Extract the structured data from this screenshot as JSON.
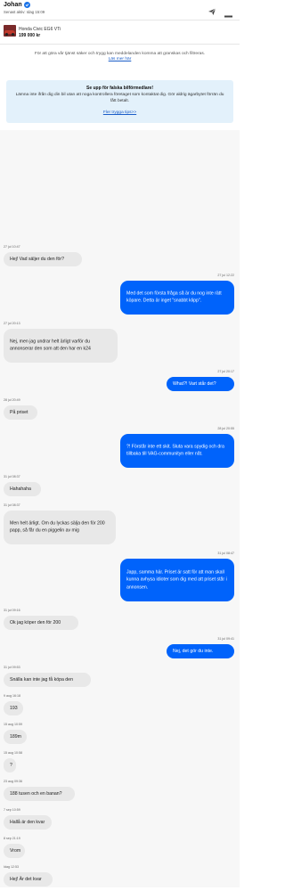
{
  "header": {
    "name": "Johan",
    "last_seen": "Senast aktiv: Idag 15:09"
  },
  "listing": {
    "title": "Honda Civic EG6 VTi",
    "price": "199 000 kr"
  },
  "notice": {
    "text": "För att göra vår tjänst säker och trygg kan meddelanden komma att granskas och filtreras.",
    "link": "Läs mer här"
  },
  "warning": {
    "title": "Se upp för falska bilförmedlare!",
    "text": "Lämna inte ifrån dig din bil utan att noga kontrollera företaget som kontaktat dig. Gör aldrig ägarbytet förrän du fått betalt.",
    "link": "Fler trygga tips>>"
  },
  "messages": [
    {
      "dir": "in",
      "time": "27 jul 10:47",
      "text": "Hej! Vad säljer du den för?"
    },
    {
      "dir": "out",
      "time": "27 jul 12:22",
      "text": "Med det som första fråga så är du nog inte rätt köpare. Detta är inget \"snabbt klipp\"."
    },
    {
      "dir": "in",
      "time": "27 jul 20:13",
      "text": "Nej, men jag undrar helt ärligt varför du annonserar den som att den har en k24"
    },
    {
      "dir": "out",
      "time": "27 jul 20:17",
      "text": "What?! Vart står det?"
    },
    {
      "dir": "in",
      "time": "28 jul 20:49",
      "text": "På priset"
    },
    {
      "dir": "out",
      "time": "28 jul 20:55",
      "text": "?! Förstår inte ett skit. Sluta vara spydig och dra tillbaka till VAG-communityn eller nåt."
    },
    {
      "dir": "in",
      "time": "31 jul 08:37",
      "text": "Hahahaha"
    },
    {
      "dir": "in",
      "time": "31 jul 08:37",
      "text": "Men helt ärligt. Om du lyckas sälja den för 200 papp, så får du en piggelin av mig"
    },
    {
      "dir": "out",
      "time": "31 jul 08:47",
      "text": "Japp, samma här. Priset är satt för att man skall kunna avhysa idioter som dig med att priset står i annonsen."
    },
    {
      "dir": "in",
      "time": "31 jul 09:16",
      "text": "Ok jag köper den för 200"
    },
    {
      "dir": "out",
      "time": "31 jul 09:41",
      "text": "Nej, det gör du inte."
    },
    {
      "dir": "in",
      "time": "31 jul 09:53",
      "text": "Snälla kan inte jag få köpa den"
    },
    {
      "dir": "in",
      "time": "9 aug 16:18",
      "text": "193"
    },
    {
      "dir": "in",
      "time": "15 aug 10:59",
      "text": "189m"
    },
    {
      "dir": "in",
      "time": "15 aug 10:58",
      "text": "?"
    },
    {
      "dir": "in",
      "time": "23 aug 09:36",
      "text": "188 tusen och en banan?"
    },
    {
      "dir": "in",
      "time": "7 sep 10:59",
      "text": "Hallå är den kvar"
    },
    {
      "dir": "in",
      "time": "8 sep 21:19",
      "text": "Vrom"
    },
    {
      "dir": "in",
      "time": "Idag 12:53",
      "text": "Hej! Är det kvar"
    }
  ]
}
